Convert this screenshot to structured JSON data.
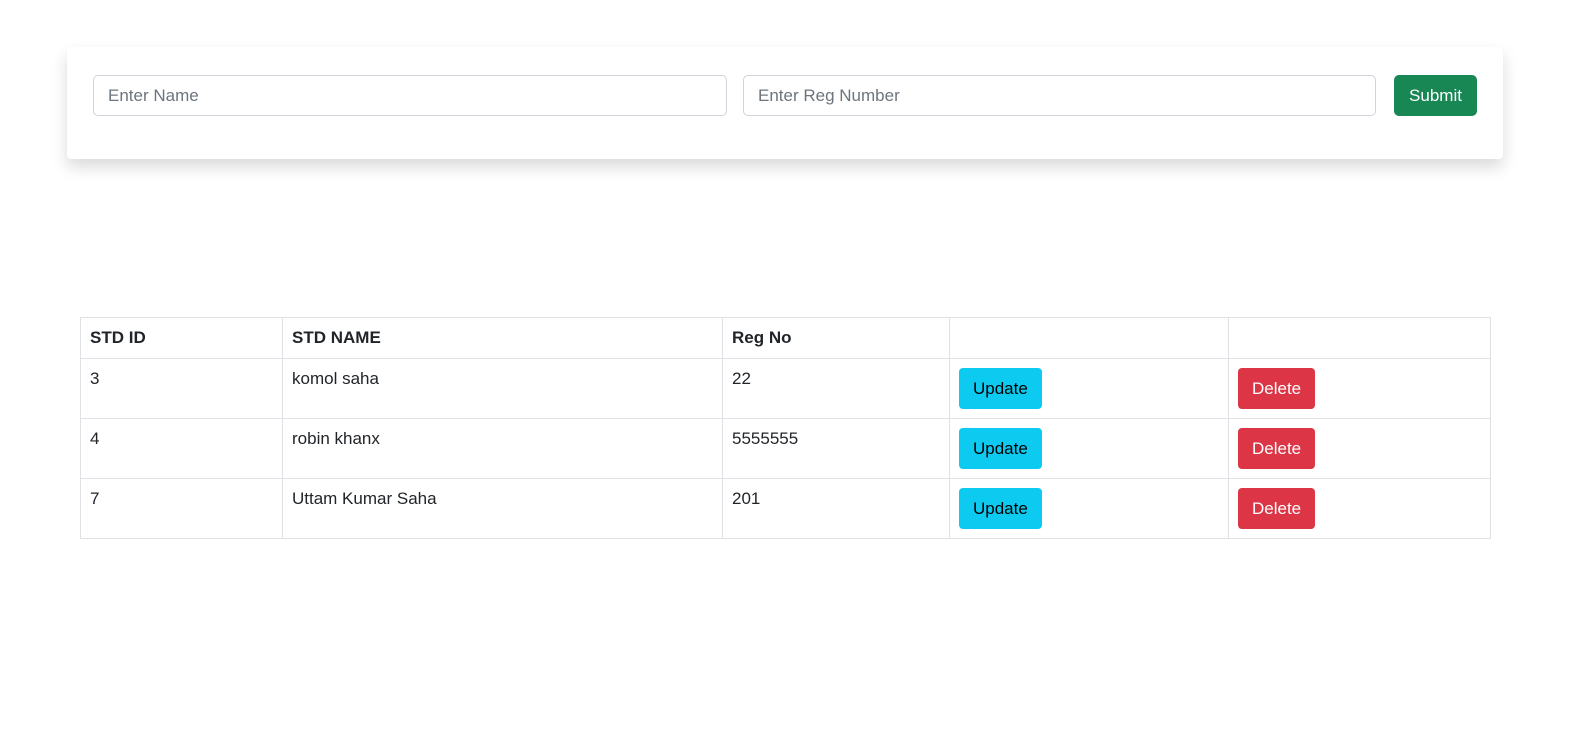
{
  "form": {
    "name_placeholder": "Enter Name",
    "name_value": "",
    "reg_placeholder": "Enter Reg Number",
    "reg_value": "",
    "submit_label": "Submit"
  },
  "table": {
    "headers": [
      "STD ID",
      "STD NAME",
      "Reg No",
      "",
      ""
    ],
    "rows": [
      {
        "id": "3",
        "name": "komol saha",
        "reg": "22",
        "update_label": "Update",
        "delete_label": "Delete"
      },
      {
        "id": "4",
        "name": "robin khanx",
        "reg": "5555555",
        "update_label": "Update",
        "delete_label": "Delete"
      },
      {
        "id": "7",
        "name": "Uttam Kumar Saha",
        "reg": "201",
        "update_label": "Update",
        "delete_label": "Delete"
      }
    ]
  },
  "colors": {
    "submit": "#198754",
    "update": "#0dcaf0",
    "delete": "#dc3545"
  }
}
